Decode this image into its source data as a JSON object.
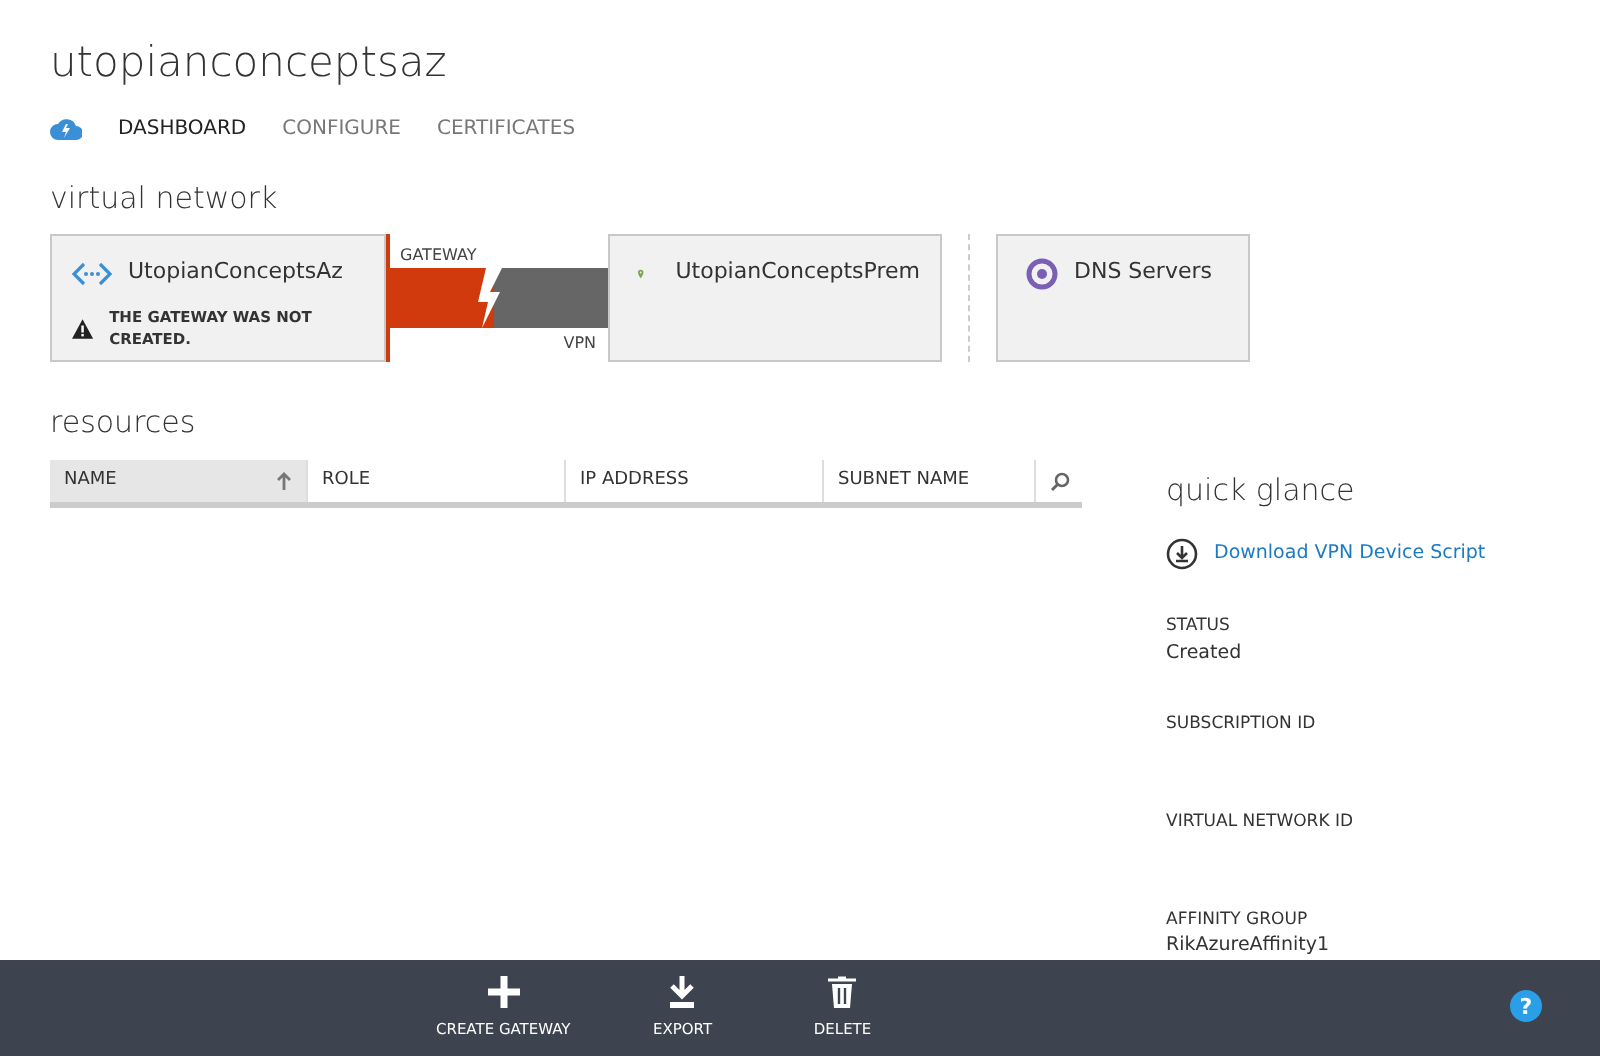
{
  "title": "utopianconceptsaz",
  "tabs": [
    {
      "label": "DASHBOARD",
      "selected": true
    },
    {
      "label": "CONFIGURE",
      "selected": false
    },
    {
      "label": "CERTIFICATES",
      "selected": false
    }
  ],
  "virtual_network": {
    "heading": "virtual network",
    "local": {
      "name": "UtopianConceptsAz",
      "warning": "THE GATEWAY WAS NOT CREATED."
    },
    "gateway": {
      "label": "GATEWAY",
      "vpn_label": "VPN",
      "created": false
    },
    "remote": {
      "name": "UtopianConceptsPrem"
    },
    "dns": {
      "name": "DNS Servers"
    }
  },
  "resources": {
    "heading": "resources",
    "columns": [
      {
        "label": "NAME",
        "sorted": true
      },
      {
        "label": "ROLE",
        "sorted": false
      },
      {
        "label": "IP ADDRESS",
        "sorted": false
      },
      {
        "label": "SUBNET NAME",
        "sorted": false
      }
    ]
  },
  "quick_glance": {
    "heading": "quick glance",
    "link": "Download VPN Device Script",
    "fields": [
      {
        "label": "STATUS",
        "value": "Created"
      },
      {
        "label": "SUBSCRIPTION ID"
      },
      {
        "label": "VIRTUAL NETWORK ID"
      },
      {
        "label": "AFFINITY GROUP",
        "value": "RikAzureAffinity1"
      }
    ]
  },
  "command_bar": {
    "commands": [
      {
        "kind": "add",
        "label": "CREATE GATEWAY"
      },
      {
        "kind": "export",
        "label": "EXPORT"
      },
      {
        "kind": "delete",
        "label": "DELETE"
      }
    ],
    "help": "?"
  }
}
